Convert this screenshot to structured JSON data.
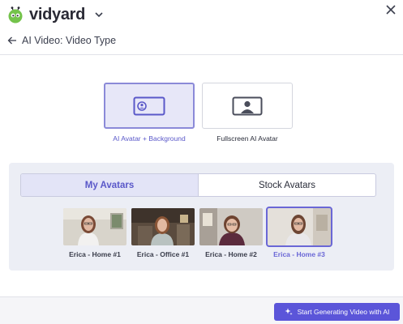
{
  "brand": {
    "name": "vidyard",
    "accent": "#5b55d9",
    "logo_green": "#74c34b"
  },
  "header": {
    "title": "AI Video: Video Type",
    "back_icon": "arrow-left-icon",
    "close_icon": "close-icon",
    "menu_icon": "chevron-down-icon"
  },
  "video_types": [
    {
      "label": "AI Avatar + Background",
      "icon": "avatar-background-icon",
      "selected": true
    },
    {
      "label": "Fullscreen AI Avatar",
      "icon": "fullscreen-avatar-icon",
      "selected": false
    }
  ],
  "avatar_tabs": [
    {
      "label": "My Avatars",
      "active": true
    },
    {
      "label": "Stock Avatars",
      "active": false
    }
  ],
  "avatars": [
    {
      "label": "Erica - Home #1",
      "selected": false
    },
    {
      "label": "Erica - Office #1",
      "selected": false
    },
    {
      "label": "Erica - Home #2",
      "selected": false
    },
    {
      "label": "Erica - Home #3",
      "selected": true
    }
  ],
  "footer": {
    "generate_label": "Start Generating Video with AI",
    "generate_icon": "sparkle-icon"
  }
}
